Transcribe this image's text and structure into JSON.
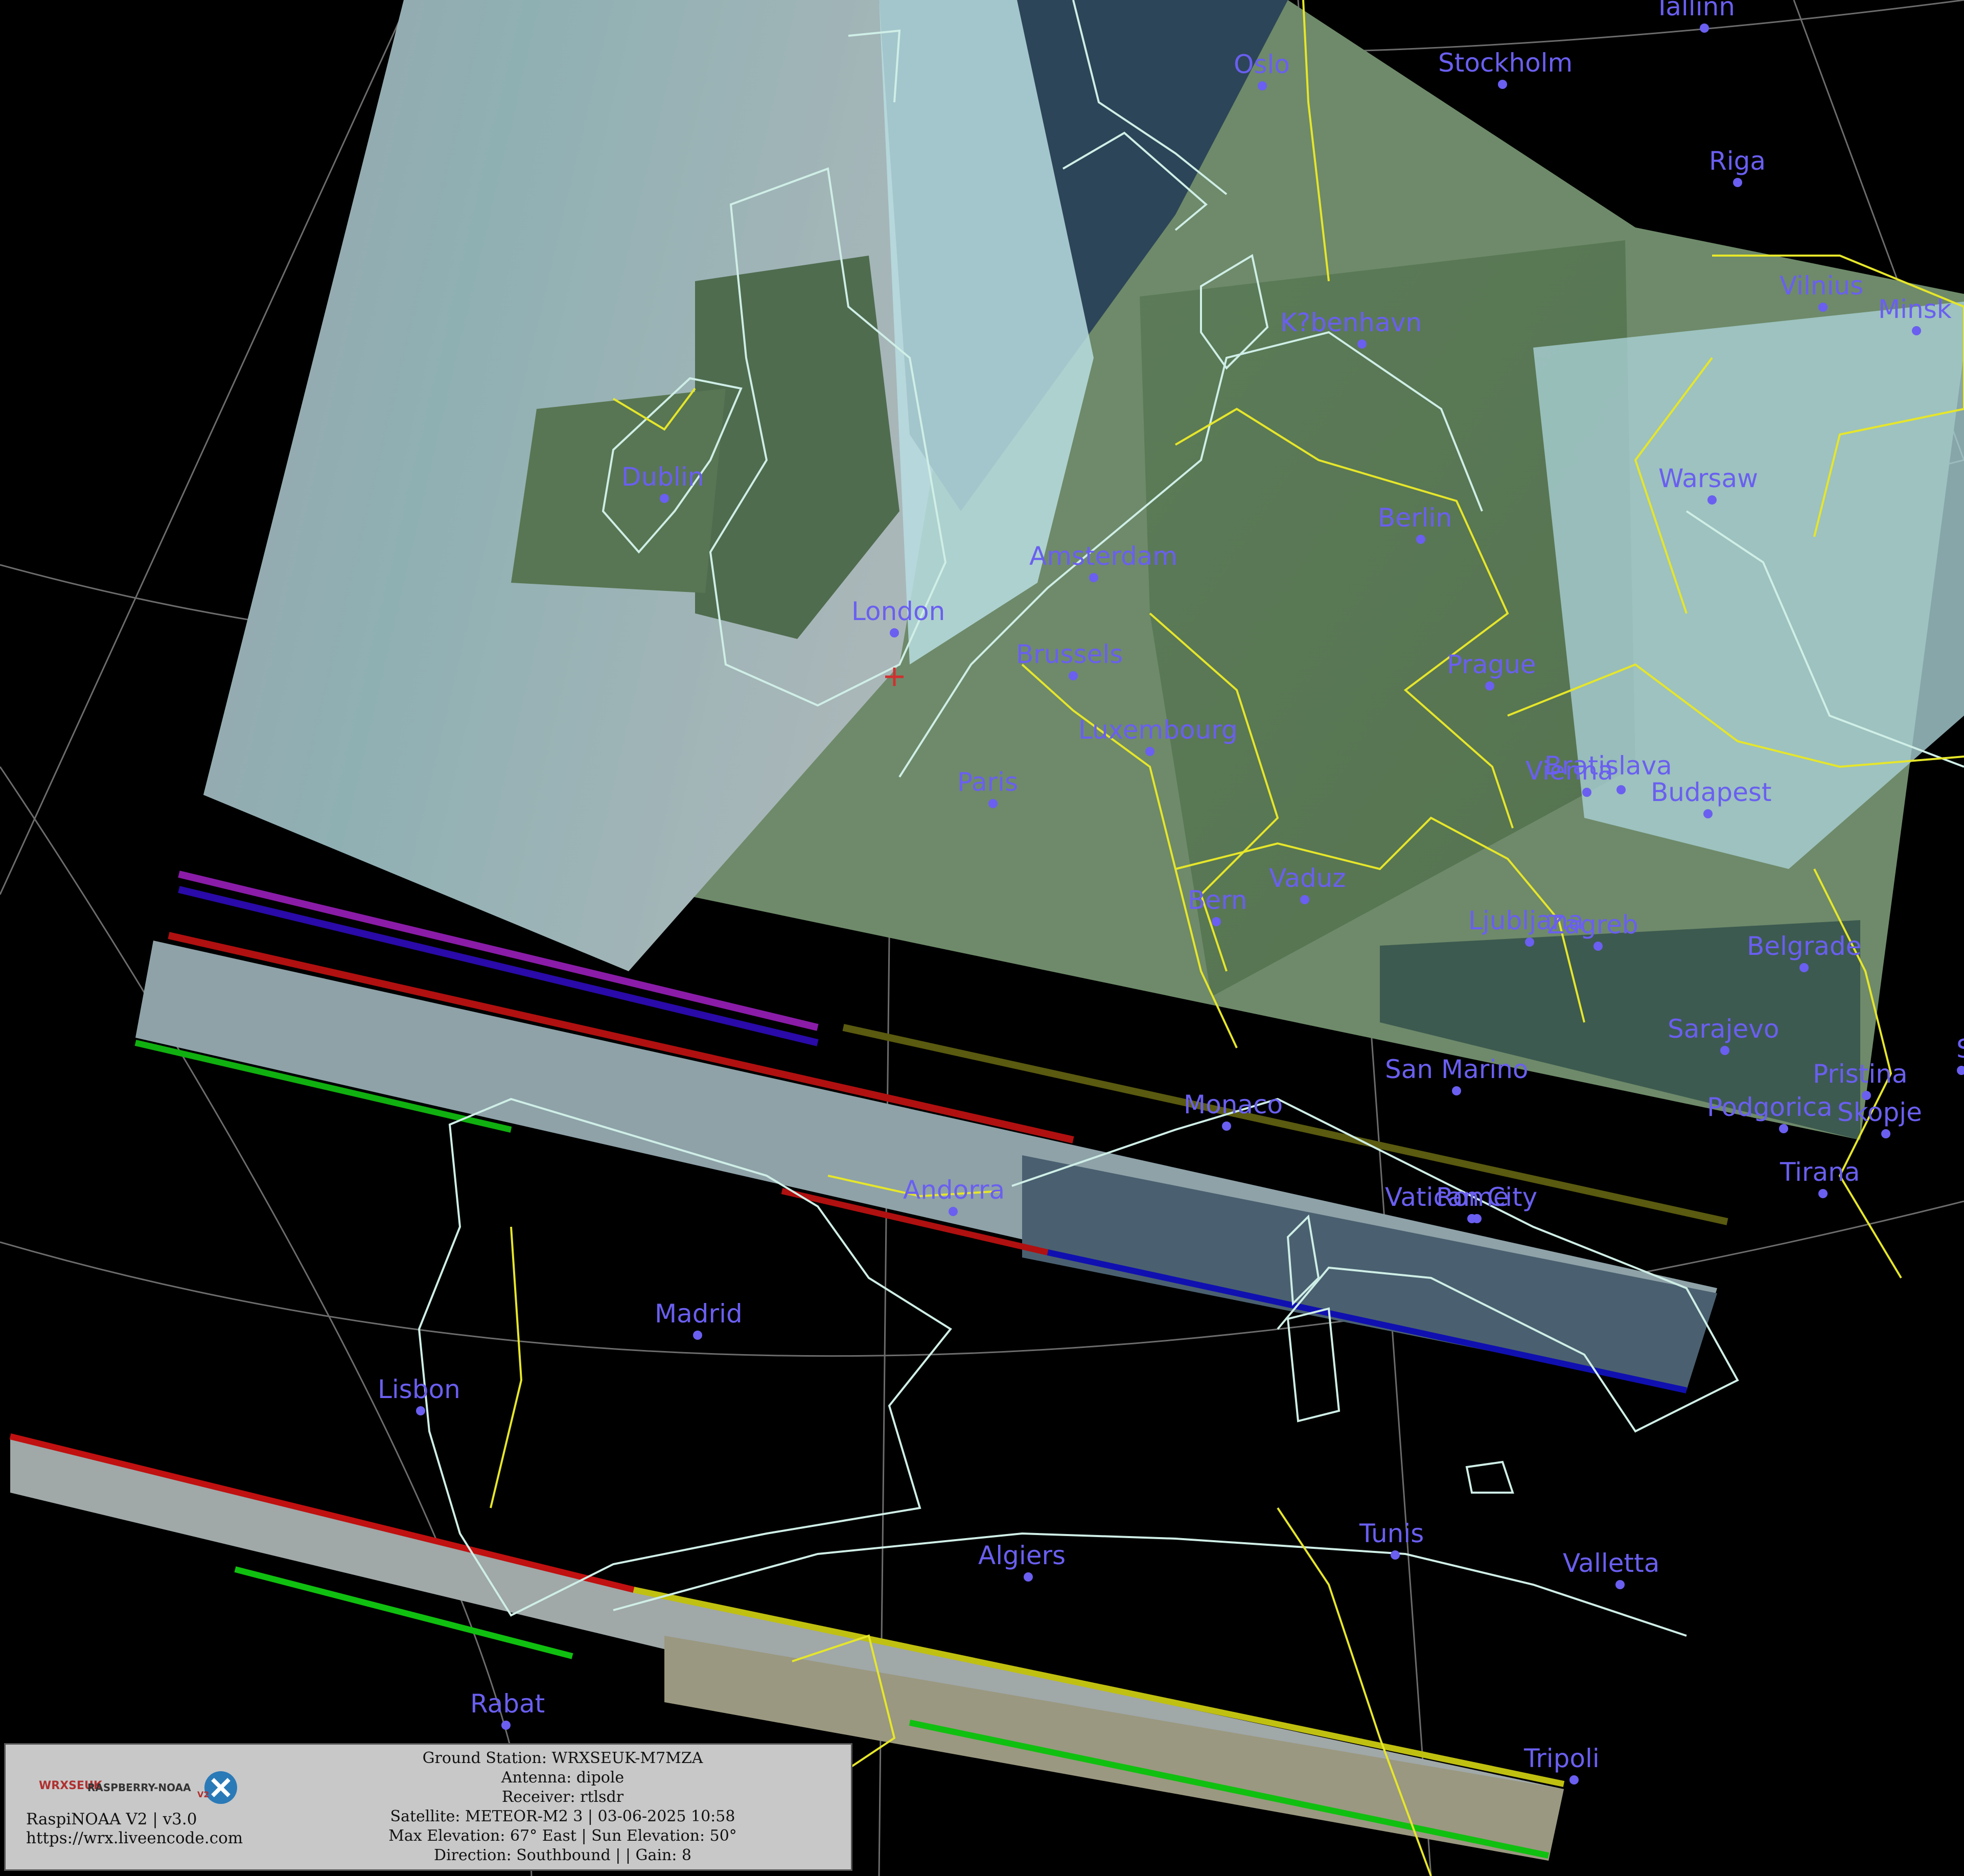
{
  "map": {
    "background_color": "#000000",
    "coast_color": "#cfeee6",
    "border_color": "#e6e62a",
    "graticule_color": "#9a9a9a",
    "label_color": "#6a5ff0",
    "cities": [
      {
        "name": "Tallinn"
      },
      {
        "name": "Oslo"
      },
      {
        "name": "Stockholm"
      },
      {
        "name": "Riga"
      },
      {
        "name": "Vilnius"
      },
      {
        "name": "Minsk"
      },
      {
        "name": "K?benhavn"
      },
      {
        "name": "Dublin"
      },
      {
        "name": "Warsaw"
      },
      {
        "name": "Berlin"
      },
      {
        "name": "Amsterdam"
      },
      {
        "name": "London"
      },
      {
        "name": "Brussels"
      },
      {
        "name": "Prague"
      },
      {
        "name": "Luxembourg"
      },
      {
        "name": "Paris"
      },
      {
        "name": "Vienna"
      },
      {
        "name": "Bratislava"
      },
      {
        "name": "Budapest"
      },
      {
        "name": "Vaduz"
      },
      {
        "name": "Bern"
      },
      {
        "name": "Ljubljana"
      },
      {
        "name": "Zagreb"
      },
      {
        "name": "Belgrade"
      },
      {
        "name": "Sarajevo"
      },
      {
        "name": "So"
      },
      {
        "name": "San Marino"
      },
      {
        "name": "Pristina"
      },
      {
        "name": "Monaco"
      },
      {
        "name": "Podgorica"
      },
      {
        "name": "Skopje"
      },
      {
        "name": "Tirana"
      },
      {
        "name": "Andorra"
      },
      {
        "name": "Vatican City"
      },
      {
        "name": "Rome"
      },
      {
        "name": "Madrid"
      },
      {
        "name": "Lisbon"
      },
      {
        "name": "Tunis"
      },
      {
        "name": "Algiers"
      },
      {
        "name": "Valletta"
      },
      {
        "name": "Rabat"
      },
      {
        "name": "Tripoli"
      }
    ]
  },
  "info_panel": {
    "logo_text_left": "WRXSEUK",
    "logo_text_right": "RASPBERRY-NOAA",
    "logo_badge": "V2",
    "app_version": "RaspiNOAA V2 | v3.0",
    "app_url": "https://wrx.liveencode.com",
    "ground_station": "Ground Station: WRXSEUK-M7MZA",
    "antenna": "Antenna: dipole",
    "receiver": "Receiver: rtlsdr",
    "satellite": "Satellite: METEOR-M2 3 | 03-06-2025 10:58",
    "elevation": "Max Elevation: 67° East | Sun Elevation: 50°",
    "direction": "Direction: Southbound | | Gain: 8"
  }
}
